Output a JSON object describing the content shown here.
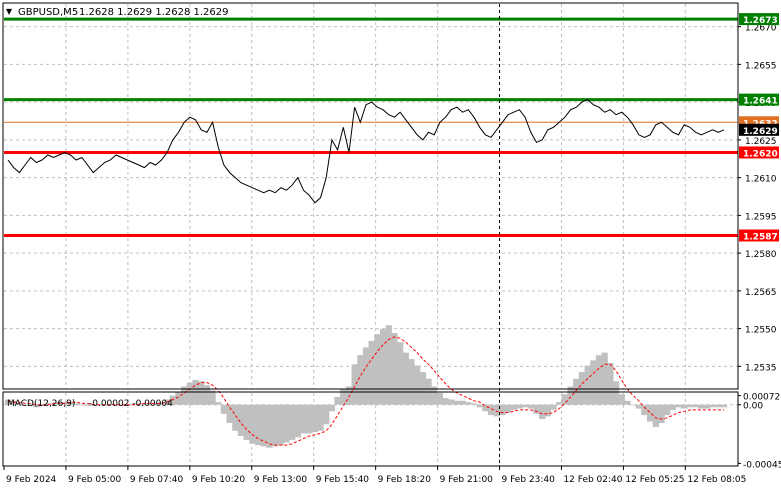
{
  "header": {
    "arrow_icon": "triangle-down-icon",
    "symbol": "GBPUSD,M5",
    "ohlc": "1.2628 1.2629 1.2628 1.2629"
  },
  "macd_label": {
    "name": "MACD(12,26,9)",
    "values": "-0.00002 -0.00004"
  },
  "colors": {
    "price_line": "#000000",
    "green_level": "#008000",
    "red_level": "#ff0000",
    "orange_level": "#e07020",
    "current_price": "#000000",
    "macd_hist": "#c0c0c0",
    "macd_signal": "#ff0000",
    "grid": "#c0c0c0"
  },
  "chart_data": [
    {
      "type": "line",
      "name": "price",
      "ylim": [
        1.2526,
        1.2679
      ],
      "y_ticks": [
        "1.2670",
        "1.2655",
        "1.2640",
        "1.2625",
        "1.2610",
        "1.2595",
        "1.2580",
        "1.2565",
        "1.2550",
        "1.2535"
      ],
      "x_ticks": [
        "9 Feb 2024",
        "9 Feb 05:00",
        "9 Feb 07:40",
        "9 Feb 10:20",
        "9 Feb 13:00",
        "9 Feb 15:40",
        "9 Feb 18:20",
        "9 Feb 21:00",
        "9 Feb 23:40",
        "12 Feb 02:40",
        "12 Feb 05:25",
        "12 Feb 08:05"
      ],
      "grid": true,
      "vertical_marker_at": "9 Feb 23:40",
      "levels": [
        {
          "label": "1.2673",
          "value": 1.2673,
          "color": "green"
        },
        {
          "label": "1.2641",
          "value": 1.2641,
          "color": "green"
        },
        {
          "label": "1.2632",
          "value": 1.2632,
          "color": "orange"
        },
        {
          "label": "1.2629",
          "value": 1.2629,
          "color": "black",
          "current": true
        },
        {
          "label": "1.2620",
          "value": 1.262,
          "color": "red"
        },
        {
          "label": "1.2587",
          "value": 1.2587,
          "color": "red"
        }
      ],
      "values": [
        1.2617,
        1.2614,
        1.2612,
        1.2615,
        1.2618,
        1.2616,
        1.2617,
        1.2619,
        1.2618,
        1.2619,
        1.262,
        1.2619,
        1.2617,
        1.2618,
        1.2615,
        1.2612,
        1.2614,
        1.2616,
        1.2617,
        1.2619,
        1.2618,
        1.2617,
        1.2616,
        1.2615,
        1.2614,
        1.2616,
        1.2615,
        1.2617,
        1.262,
        1.2625,
        1.2628,
        1.2632,
        1.2634,
        1.2633,
        1.2629,
        1.2628,
        1.2632,
        1.2622,
        1.2615,
        1.2612,
        1.261,
        1.2608,
        1.2607,
        1.2606,
        1.2605,
        1.2604,
        1.2605,
        1.2604,
        1.2606,
        1.2605,
        1.2607,
        1.261,
        1.2605,
        1.2603,
        1.26,
        1.2602,
        1.261,
        1.2625,
        1.2621,
        1.263,
        1.262,
        1.2638,
        1.2632,
        1.2639,
        1.264,
        1.2638,
        1.2637,
        1.2635,
        1.2634,
        1.2636,
        1.2633,
        1.263,
        1.2627,
        1.2625,
        1.2628,
        1.2627,
        1.2632,
        1.2634,
        1.2637,
        1.2638,
        1.2636,
        1.2637,
        1.2634,
        1.263,
        1.2627,
        1.2626,
        1.2629,
        1.2632,
        1.2635,
        1.2636,
        1.2637,
        1.2634,
        1.2628,
        1.2624,
        1.2625,
        1.2629,
        1.263,
        1.2632,
        1.2634,
        1.2637,
        1.2638,
        1.264,
        1.2641,
        1.2639,
        1.2638,
        1.2636,
        1.2637,
        1.2635,
        1.2636,
        1.2634,
        1.2631,
        1.2627,
        1.2626,
        1.2627,
        1.2631,
        1.2632,
        1.263,
        1.2628,
        1.2627,
        1.2631,
        1.263,
        1.2628,
        1.2627,
        1.2628,
        1.2629,
        1.2628,
        1.2629
      ]
    },
    {
      "type": "bar",
      "name": "MACD(12,26,9)",
      "ylim": [
        -0.00047,
        9e-05
      ],
      "y_ticks": [
        "0.00072",
        "0.00",
        "-0.00045"
      ],
      "grid": true,
      "histogram": [
        4e-05,
        3e-05,
        1e-05,
        0.0,
        -1e-05,
        -2e-05,
        0.0,
        1e-05,
        1e-05,
        2e-05,
        2e-05,
        2e-05,
        1e-05,
        0.0,
        -1e-05,
        -1e-05,
        0.0,
        0.0,
        0.0,
        0.0,
        -1e-05,
        0.0,
        0.0,
        1e-05,
        1e-05,
        1e-05,
        1e-05,
        2e-05,
        4e-05,
        7e-05,
        0.0001,
        0.00014,
        0.00017,
        0.00019,
        0.00018,
        0.00015,
        0.00011,
        2e-05,
        -7e-05,
        -0.00014,
        -0.0002,
        -0.00024,
        -0.00027,
        -0.0003,
        -0.00031,
        -0.00032,
        -0.00033,
        -0.00032,
        -0.00031,
        -0.00029,
        -0.00027,
        -0.00025,
        -0.00022,
        -0.00022,
        -0.00021,
        -0.0002,
        -0.00015,
        -5e-05,
        6e-05,
        0.00012,
        0.00014,
        0.00031,
        0.00038,
        0.00044,
        0.00049,
        0.00054,
        0.00058,
        0.00061,
        0.00055,
        0.00048,
        0.0004,
        0.00035,
        0.0003,
        0.00025,
        0.0002,
        0.00014,
        9e-05,
        5e-05,
        4e-05,
        3e-05,
        3e-05,
        2e-05,
        1e-05,
        -2e-05,
        -5e-05,
        -8e-05,
        -9e-05,
        -8e-05,
        -6e-05,
        -4e-05,
        -3e-05,
        -2e-05,
        -3e-05,
        -7e-05,
        -0.00011,
        -9e-05,
        -4e-05,
        2e-05,
        8e-05,
        0.00014,
        0.0002,
        0.00025,
        0.0003,
        0.00034,
        0.00038,
        0.0004,
        0.00032,
        0.00018,
        8e-05,
        3e-05,
        0.0,
        -3e-05,
        -8e-05,
        -0.00013,
        -0.00017,
        -0.00014,
        -8e-05,
        -4e-05,
        -2e-05,
        -3e-05,
        -2e-05,
        -2e-05,
        -3e-05,
        -3e-05,
        -2e-05,
        -2e-05,
        -2e-05
      ],
      "signal": [
        3e-05,
        2e-05,
        2e-05,
        1e-05,
        1e-05,
        0.0,
        0.0,
        0.0,
        1e-05,
        1e-05,
        1e-05,
        2e-05,
        2e-05,
        1e-05,
        1e-05,
        0.0,
        0.0,
        0.0,
        0.0,
        0.0,
        0.0,
        0.0,
        0.0,
        0.0,
        1e-05,
        1e-05,
        1e-05,
        1e-05,
        2e-05,
        4e-05,
        6e-05,
        9e-05,
        0.00012,
        0.00015,
        0.00017,
        0.00017,
        0.00015,
        0.00011,
        5e-05,
        -2e-05,
        -8e-05,
        -0.00014,
        -0.00019,
        -0.00023,
        -0.00026,
        -0.00028,
        -0.0003,
        -0.00031,
        -0.00031,
        -0.00031,
        -0.0003,
        -0.00028,
        -0.00026,
        -0.00024,
        -0.00023,
        -0.00022,
        -0.0002,
        -0.00015,
        -8e-05,
        -1e-05,
        6e-05,
        0.00014,
        0.00022,
        0.00029,
        0.00035,
        0.00041,
        0.00046,
        0.0005,
        0.00052,
        0.00051,
        0.00048,
        0.00044,
        0.0004,
        0.00035,
        0.00031,
        0.00026,
        0.00021,
        0.00016,
        0.00012,
        9e-05,
        7e-05,
        5e-05,
        3e-05,
        2e-05,
        -1e-05,
        -3e-05,
        -5e-05,
        -6e-05,
        -6e-05,
        -5e-05,
        -4e-05,
        -4e-05,
        -4e-05,
        -5e-05,
        -7e-05,
        -7e-05,
        -6e-05,
        -3e-05,
        1e-05,
        6e-05,
        0.00011,
        0.00016,
        0.0002,
        0.00024,
        0.00028,
        0.00031,
        0.00031,
        0.00026,
        0.00019,
        0.00012,
        7e-05,
        3e-05,
        -2e-05,
        -6e-05,
        -0.0001,
        -0.00011,
        -0.0001,
        -8e-05,
        -6e-05,
        -5e-05,
        -4e-05,
        -4e-05,
        -4e-05,
        -4e-05,
        -4e-05,
        -4e-05,
        -4e-05
      ]
    }
  ]
}
